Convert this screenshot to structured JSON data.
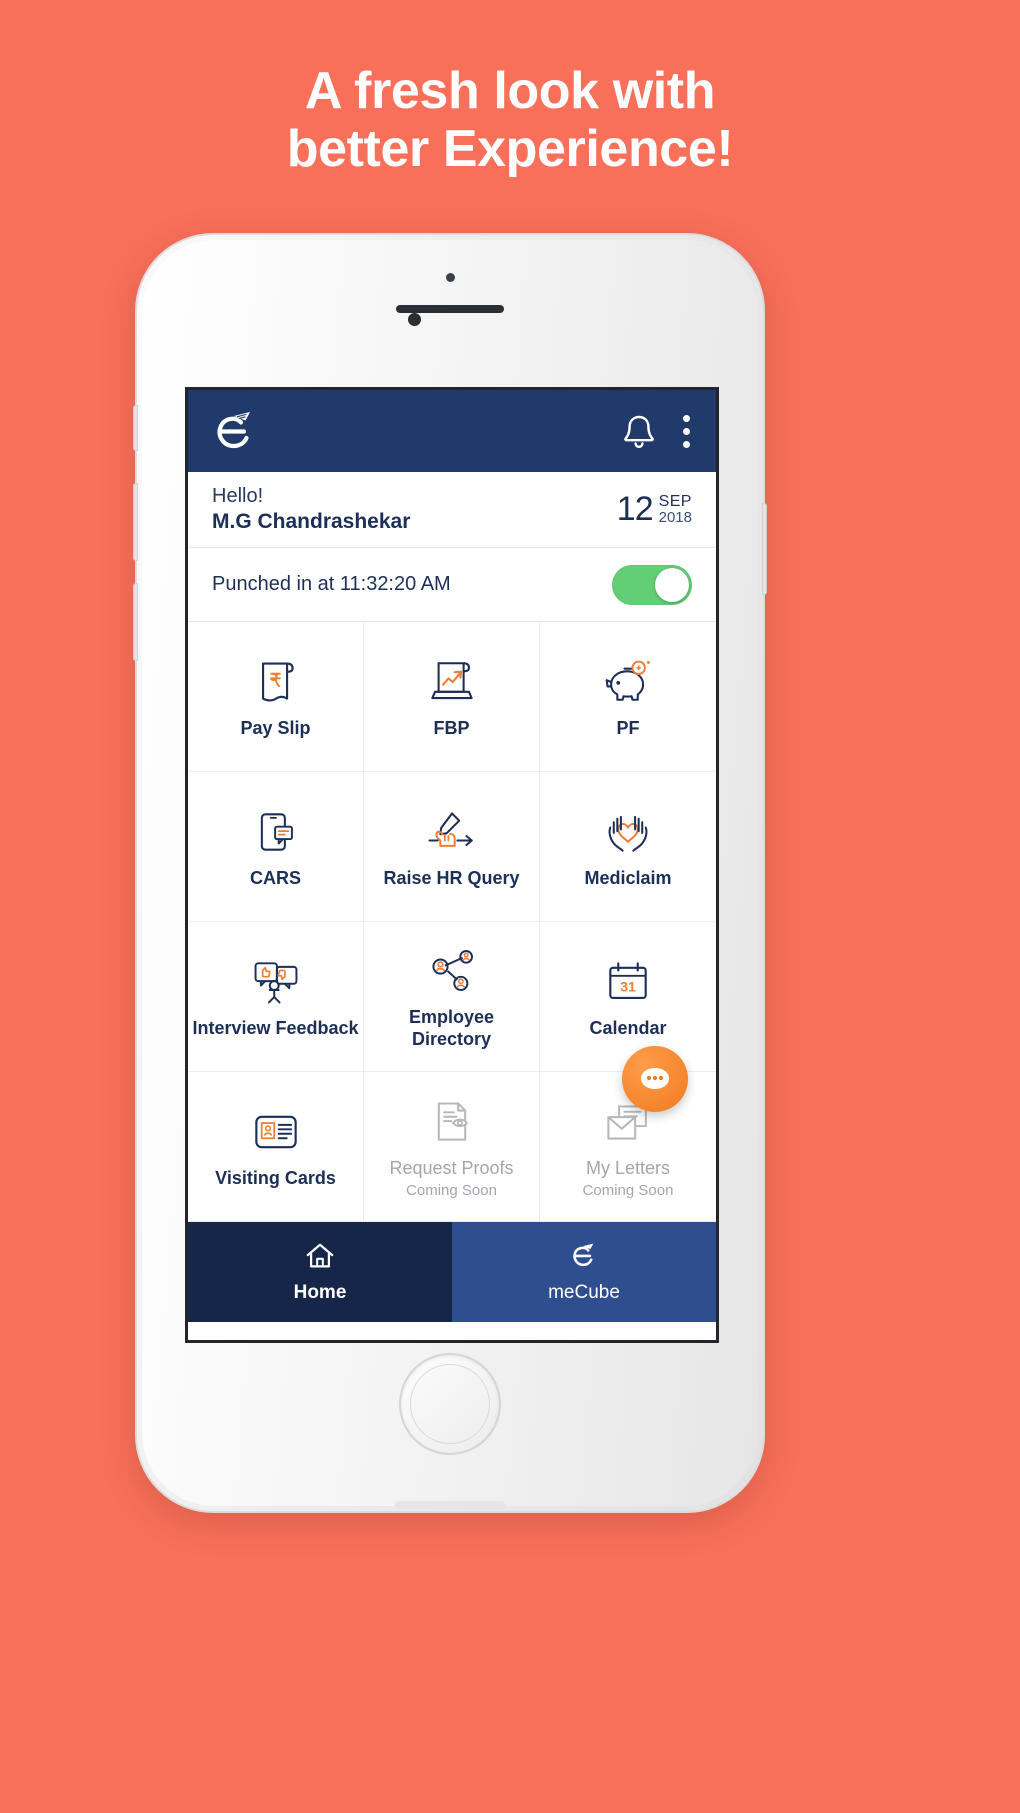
{
  "promo": {
    "headline_line1": "A fresh look with",
    "headline_line2": "better Experience!",
    "background_color": "#F8705A",
    "text_color": "#FFFFFF"
  },
  "app": {
    "appbar": {
      "logo_name": "meCube logo",
      "brand_color": "#203A6B",
      "notifications_icon": "bell-icon",
      "overflow_icon": "kebab-menu-icon"
    },
    "greeting": {
      "salutation": "Hello!",
      "user_name": "M.G Chandrashekar",
      "date_day": "12",
      "date_month": "SEP",
      "date_year": "2018"
    },
    "attendance": {
      "status_text": "Punched in at 11:32:20 AM",
      "toggle_state": "on",
      "toggle_color": "#62CE76"
    },
    "grid": [
      {
        "label": "Pay Slip",
        "sub": "",
        "icon": "payslip-rupee-document-icon",
        "enabled": true
      },
      {
        "label": "FBP",
        "sub": "",
        "icon": "fbp-chart-laptop-icon",
        "enabled": true
      },
      {
        "label": "PF",
        "sub": "",
        "icon": "pf-piggy-bank-icon",
        "enabled": true
      },
      {
        "label": "CARS",
        "sub": "",
        "icon": "cars-mobile-icon",
        "enabled": true
      },
      {
        "label": "Raise HR Query",
        "sub": "",
        "icon": "hr-query-hand-pen-icon",
        "enabled": true
      },
      {
        "label": "Mediclaim",
        "sub": "",
        "icon": "mediclaim-hands-heart-icon",
        "enabled": true
      },
      {
        "label": "Interview Feedback",
        "sub": "",
        "icon": "interview-feedback-thumbs-icon",
        "enabled": true
      },
      {
        "label": "Employee Directory",
        "sub": "",
        "icon": "employee-directory-network-icon",
        "enabled": true
      },
      {
        "label": "Calendar",
        "sub": "",
        "icon": "calendar-31-icon",
        "enabled": true
      },
      {
        "label": "Visiting Cards",
        "sub": "",
        "icon": "visiting-cards-id-icon",
        "enabled": true
      },
      {
        "label": "Request Proofs",
        "sub": "Coming Soon",
        "icon": "request-proofs-document-eye-icon",
        "enabled": false
      },
      {
        "label": "My Letters",
        "sub": "Coming Soon",
        "icon": "my-letters-envelope-icon",
        "enabled": false
      }
    ],
    "fab": {
      "icon": "chat-support-icon",
      "color": "#F07B20"
    },
    "bottom_nav": [
      {
        "label": "Home",
        "icon": "home-icon",
        "active": true
      },
      {
        "label": "meCube",
        "icon": "mecube-logo-icon",
        "active": false
      }
    ],
    "calendar_day_number": "31",
    "accent_navy": "#1C2F57",
    "accent_orange": "#EC7E35"
  }
}
